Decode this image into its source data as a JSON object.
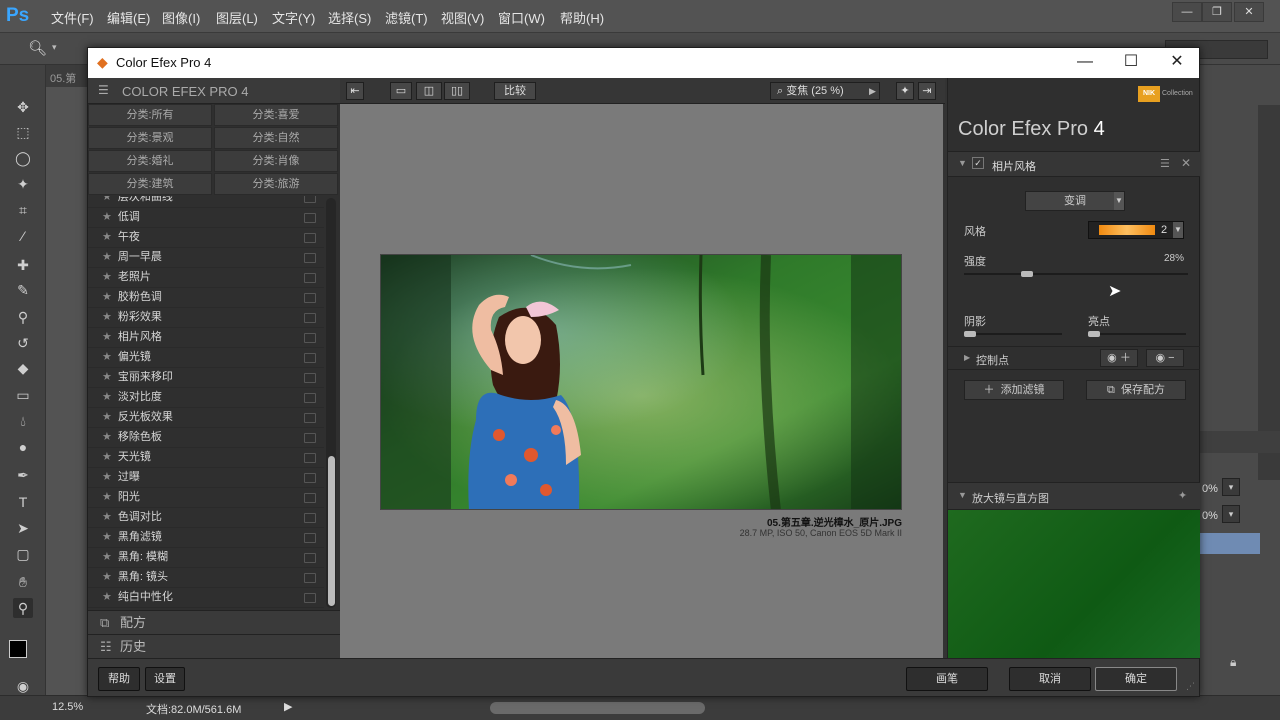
{
  "ps": {
    "logo": "Ps",
    "menus": [
      "文件(F)",
      "编辑(E)",
      "图像(I)",
      "图层(L)",
      "文字(Y)",
      "选择(S)",
      "滤镜(T)",
      "视图(V)",
      "窗口(W)",
      "帮助(H)"
    ],
    "doc_tab": "05.第",
    "zoom": "12.5%",
    "doc_size": "文档:82.0M/561.6M",
    "right_pct": [
      "0%",
      "0%"
    ]
  },
  "dialog": {
    "title": "Color Efex Pro 4",
    "left": {
      "header": "COLOR EFEX PRO 4",
      "categories": [
        "分类:所有",
        "分类:喜爱",
        "分类:景观",
        "分类:自然",
        "分类:婚礼",
        "分类:肖像",
        "分类:建筑",
        "分类:旅游"
      ],
      "filters": [
        "层次和曲线",
        "低调",
        "午夜",
        "周一早晨",
        "老照片",
        "胶粉色调",
        "粉彩效果",
        "相片风格",
        "偏光镜",
        "宝丽来移印",
        "淡对比度",
        "反光板效果",
        "移除色板",
        "天光镜",
        "过曝",
        "阳光",
        "色调对比",
        "黑角滤镜",
        "黑角: 模糊",
        "黑角: 镜头",
        "纯白中性化"
      ],
      "recipes": "配方",
      "history": "历史"
    },
    "center": {
      "compare": "比较",
      "zoom": "变焦 (25 %)",
      "file_name": "05.第五章.逆光樟水_原片.JPG",
      "file_meta": "28.7 MP, ISO 50, Canon EOS 5D Mark II"
    },
    "right": {
      "product": "Color Efex Pro",
      "version": "4",
      "nik": "NIK",
      "collection": "Collection",
      "filter_name": "相片风格",
      "mode": "变调",
      "style_label": "风格",
      "style_num": "2",
      "strength_label": "强度",
      "strength_value": "28%",
      "strength": 0.28,
      "shadow_label": "阴影",
      "highlight_label": "亮点",
      "control_points": "控制点",
      "add_filter": "添加滤镜",
      "save_recipe": "保存配方",
      "loupe": "放大镜与直方图"
    },
    "bottom": {
      "help": "帮助",
      "settings": "设置",
      "brush": "画笔",
      "cancel": "取消",
      "ok": "确定"
    }
  }
}
